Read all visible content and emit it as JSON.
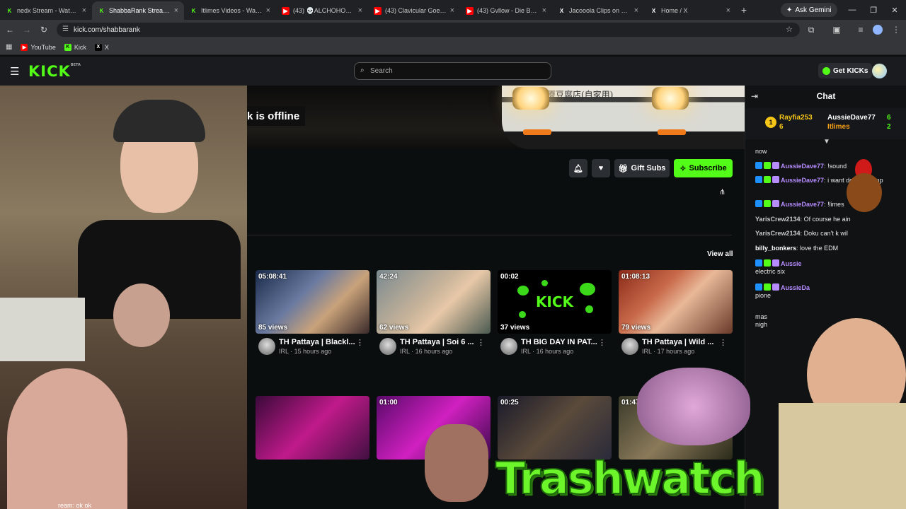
{
  "browser": {
    "tabs": [
      {
        "title": "nedx Stream - Watch Li",
        "icon": "kick-icon",
        "color": "#53fc18"
      },
      {
        "title": "ShabbaRank Stream - W",
        "icon": "kick-icon",
        "color": "#53fc18",
        "active": true
      },
      {
        "title": "Itlimes Videos - Watch",
        "icon": "kick-icon",
        "color": "#53fc18"
      },
      {
        "title": "(43) 💀ALCHOHOLIC W",
        "icon": "youtube-icon",
        "color": "#ff0000"
      },
      {
        "title": "(43) Clavicular Goes to",
        "icon": "youtube-icon",
        "color": "#ff0000"
      },
      {
        "title": "(43) Gvllow - Die By Yo",
        "icon": "youtube-icon",
        "color": "#ff0000"
      },
      {
        "title": "Jacooola Clips on X: \"K",
        "icon": "x-icon",
        "color": "#000000"
      },
      {
        "title": "Home / X",
        "icon": "x-icon",
        "color": "#000000"
      }
    ],
    "gemini_label": "Ask Gemini",
    "url": "kick.com/shabbarank",
    "bookmarks": [
      {
        "label": "YouTube",
        "icon": "youtube-icon"
      },
      {
        "label": "Kick",
        "icon": "kick-icon"
      },
      {
        "label": "X",
        "icon": "x-icon"
      }
    ]
  },
  "kick": {
    "logo": "KICK",
    "logo_sup": "BETA",
    "search_placeholder": "Search",
    "get_kicks_label": "Get KICKs",
    "accent": "#53fc18"
  },
  "channel": {
    "offline_text": "k is offline",
    "buttons": {
      "gift_subs": "Gift Subs",
      "subscribe": "Subscribe"
    },
    "view_all": "View all"
  },
  "videos": [
    {
      "duration": "05:08:41",
      "views": "85 views",
      "title": "Pattaya | Blackl...",
      "flag": "TH",
      "sub": "IRL · 15 hours ago"
    },
    {
      "duration": "42:24",
      "views": "62 views",
      "title": "Pattaya | Soi 6 ...",
      "flag": "TH",
      "sub": "IRL · 16 hours ago"
    },
    {
      "duration": "00:02",
      "views": "37 views",
      "title": "BIG DAY IN PAT...",
      "flag": "TH",
      "sub": "IRL · 16 hours ago"
    },
    {
      "duration": "01:08:13",
      "views": "79 views",
      "title": "Pattaya | Wild ...",
      "flag": "TH",
      "sub": "IRL · 17 hours ago"
    }
  ],
  "videos_row2": [
    {
      "duration": ""
    },
    {
      "duration": "01:00"
    },
    {
      "duration": "00:25"
    },
    {
      "duration": "01:47"
    }
  ],
  "chat": {
    "title": "Chat",
    "leaders": [
      {
        "name": "Rayfia253",
        "count": "6"
      },
      {
        "name": "AussieDave77",
        "count": "6"
      },
      {
        "name": "Itlimes",
        "count": "2"
      }
    ],
    "messages": [
      {
        "user": "",
        "text": "now",
        "color": "#ffffff"
      },
      {
        "user": "AussieDave77",
        "text": "!sound",
        "color": "#b68cff"
      },
      {
        "user": "AussieDave77",
        "text": "i want donald trump",
        "color": "#b68cff"
      },
      {
        "user": "AussieDave77",
        "text": "!limes",
        "color": "#b68cff"
      },
      {
        "user": "YarisCrew2134",
        "text": "Of course he ain",
        "color": "#c8c8c8"
      },
      {
        "user": "YarisCrew2134",
        "text": "Doku can't k wil",
        "color": "#c8c8c8"
      },
      {
        "user": "billy_bonkers",
        "text": "love  the  EDM",
        "color": "#ffffff"
      },
      {
        "user": "Aussie",
        "text": "electric six",
        "color": "#b68cff"
      },
      {
        "user": "AussieDa",
        "text": "pione",
        "color": "#b68cff"
      },
      {
        "user": "",
        "text": "mas nigh",
        "color": "#ffffff"
      }
    ]
  },
  "overlay": {
    "logo_text": "Trashwatch",
    "caption": "ream: ok ok"
  }
}
